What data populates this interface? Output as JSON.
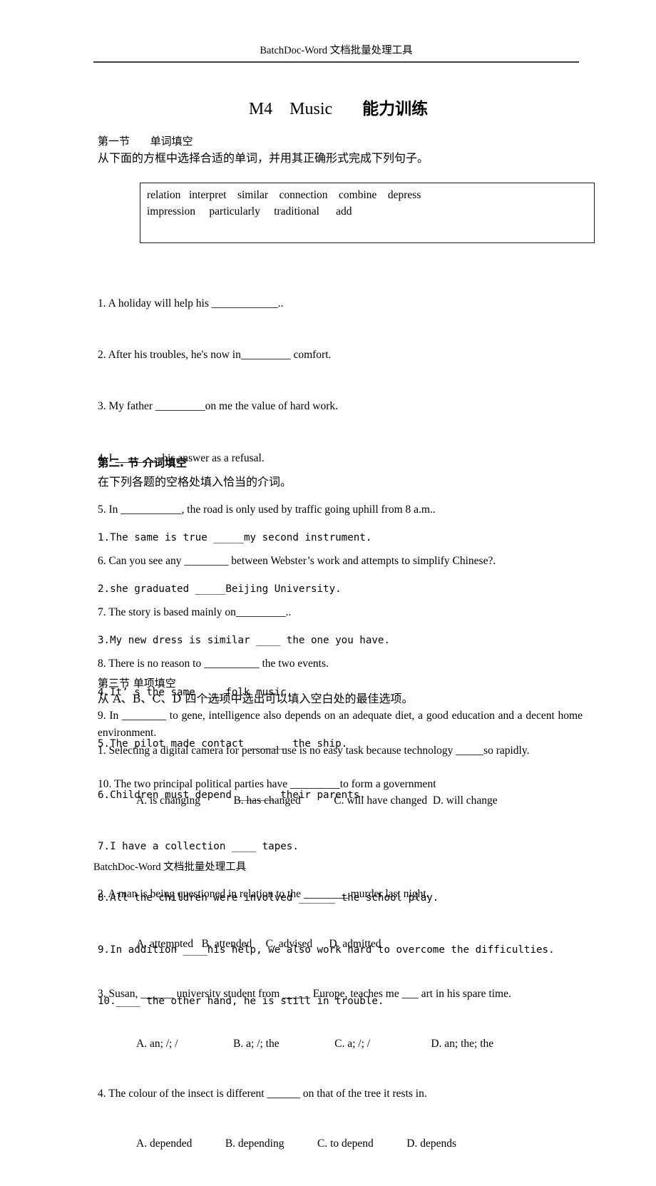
{
  "header": {
    "text": "BatchDoc-Word 文档批量处理工具"
  },
  "footer": {
    "text": "BatchDoc-Word 文档批量处理工具"
  },
  "title": {
    "en": "M4    Music       ",
    "cn": "能力训练"
  },
  "section1": {
    "heading": "第一节      单词填空",
    "instruction": "从下面的方框中选择合适的单词，并用其正确形式完成下列句子。",
    "word_bank": {
      "row1": "relation   interpret    similar    connection    combine    depress",
      "row2": "impression     particularly     traditional      add"
    },
    "items": [
      "1. A holiday will help his ____________..",
      "2. After his troubles, he's now in_________ comfort.",
      "3. My father _________on me the value of hard work.",
      "4. I ________ his answer as a refusal.",
      "5. In ___________, the road is only used by traffic going uphill from 8 a.m..",
      "6. Can you see any ________ between Webster’s work and attempts to simplify Chinese?.",
      "7. The story is based mainly on_________..",
      "8. There is no reason to __________ the two events.",
      "9. In ________ to gene, intelligence also depends on an adequate diet, a good education and a decent home environment.",
      "10. The two principal political parties have _________to form a government"
    ]
  },
  "section2": {
    "heading": "第二. 节 介词填空",
    "instruction": "在下列各题的空格处填入恰当的介词。",
    "items": [
      "1.The same is true _____my second instrument.",
      "2.she graduated _____Beijing University.",
      "3.My new dress is similar ____ the one you have.",
      "4.It’ s the same ____folk music.",
      "5.The pilot made contact ______ the ship.",
      "6.Children must depend ______ their parents.",
      "7.I have a collection ____ tapes.",
      "8.All the children were involved ______ the school play.",
      "9.In addition ____his help, we also work hard to overcome the difficulties.",
      "10.____ the other hand, he is still in trouble."
    ]
  },
  "section3": {
    "heading": "第三节 单项填空",
    "instruction": "从 A、B、C、D 四个选项中选出可以填入空白处的最佳选项。",
    "questions": [
      {
        "stem": "1. Selecting a digital camera for personal use is no easy task because technology _____so rapidly.",
        "options": "A. is changing            B. has changed            C. will have changed  D. will change",
        "gap_after": true
      },
      {
        "stem": "2. A man is being questioned in relation to the ________ murder last night.",
        "options": "A. attempted   B. attended     C. advised      D. admitted",
        "gap_after": false
      },
      {
        "stem": "3. Susan, ______ university student from _____ Europe, teaches me ___ art in his spare time.",
        "options": "A. an; /; /                    B. a; /; the                    C. a; /; /                      D. an; the; the",
        "gap_after": false
      },
      {
        "stem": "4. The colour of the insect is different ______ on that of the tree it rests in.",
        "options": "A. depended            B. depending            C. to depend            D. depends",
        "gap_after": false
      }
    ]
  }
}
